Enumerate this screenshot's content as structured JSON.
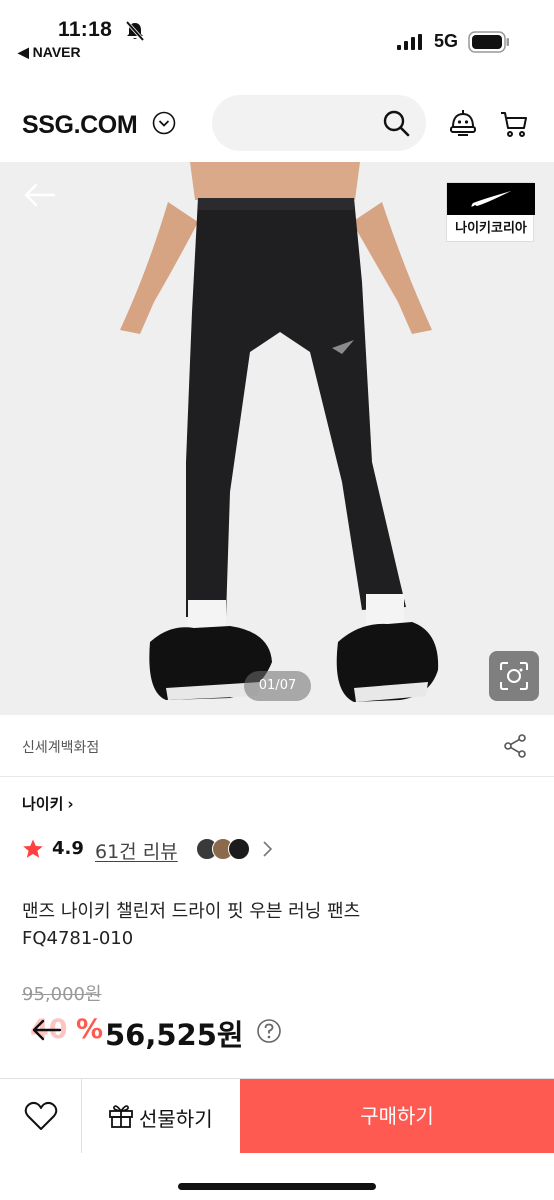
{
  "status_bar": {
    "time": "11:18",
    "back_app": "◀ NAVER",
    "network": "5G"
  },
  "header": {
    "logo": "SSG.COM",
    "search_placeholder": ""
  },
  "product_image": {
    "badge_text": "나이키코리아",
    "counter": "01/07"
  },
  "seller": {
    "name": "신세계백화점"
  },
  "brand": {
    "label": "나이키",
    "chevron": "›"
  },
  "rating": {
    "value": "4.9",
    "reviews": "61건 리뷰"
  },
  "product": {
    "title_line1": "맨즈 나이키 챌린저 드라이 핏 우븐 러닝 팬츠",
    "title_line2": "FQ4781-010"
  },
  "price": {
    "original": "95,000원",
    "discount_rate": "40",
    "discount_symbol": "%",
    "sale": "56,525원"
  },
  "bottom_bar": {
    "gift_label": "선물하기",
    "buy_label": "구매하기"
  },
  "colors": {
    "accent": "#ff5a52",
    "star": "#ff4040",
    "text": "#111111"
  }
}
